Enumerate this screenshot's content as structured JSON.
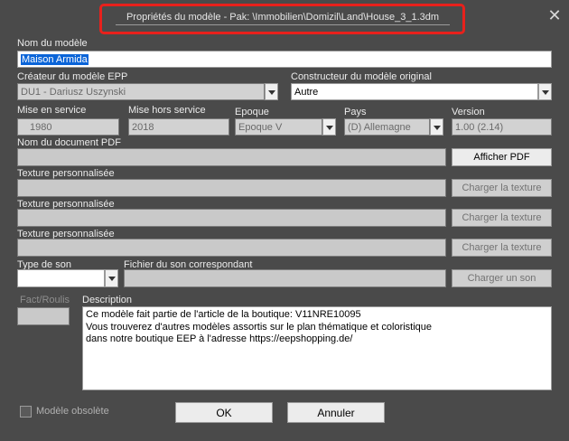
{
  "window": {
    "title": "Propriétés du modèle - Pak: \\Immobilien\\Domizil\\Land\\House_3_1.3dm",
    "close_glyph": "✕"
  },
  "model_name": {
    "label": "Nom du modèle",
    "value": "Maison Armida"
  },
  "epp_creator": {
    "label": "Créateur du modèle EPP",
    "value": "DU1 - Dariusz Uszynski"
  },
  "original_builder": {
    "label": "Constructeur du modèle original",
    "value": "Autre"
  },
  "service_start": {
    "label": "Mise en service",
    "value": "1980"
  },
  "service_end": {
    "label": "Mise hors service",
    "value": "2018"
  },
  "epoch": {
    "label": "Epoque",
    "value": "Epoque V"
  },
  "country": {
    "label": "Pays",
    "value": "(D) Allemagne"
  },
  "version": {
    "label": "Version",
    "value": "1.00  (2.14)"
  },
  "pdf": {
    "label": "Nom du document PDF",
    "value": "",
    "button": "Afficher PDF"
  },
  "textures": [
    {
      "label": "Texture personnalisée",
      "value": "",
      "button": "Charger la texture"
    },
    {
      "label": "Texture personnalisée",
      "value": "",
      "button": "Charger la texture"
    },
    {
      "label": "Texture personnalisée",
      "value": "",
      "button": "Charger la texture"
    }
  ],
  "sound_type": {
    "label": "Type de son",
    "value": ""
  },
  "sound_file": {
    "label": "Fichier du son correspondant",
    "value": "",
    "button": "Charger un son"
  },
  "fact_roulis": {
    "label": "Fact/Roulis",
    "value": ""
  },
  "description": {
    "label": "Description",
    "lines": [
      "Ce modèle fait partie de l'article de la boutique: V11NRE10095",
      "Vous trouverez d'autres modèles assortis sur le plan thématique et coloristique",
      "dans notre boutique EEP à l'adresse https://eepshopping.de/"
    ]
  },
  "obsolete": {
    "label": "Modèle obsolète",
    "checked": false
  },
  "buttons": {
    "ok": "OK",
    "cancel": "Annuler"
  },
  "colors": {
    "highlight_border": "#e8211c",
    "selection": "#0a64d8"
  }
}
